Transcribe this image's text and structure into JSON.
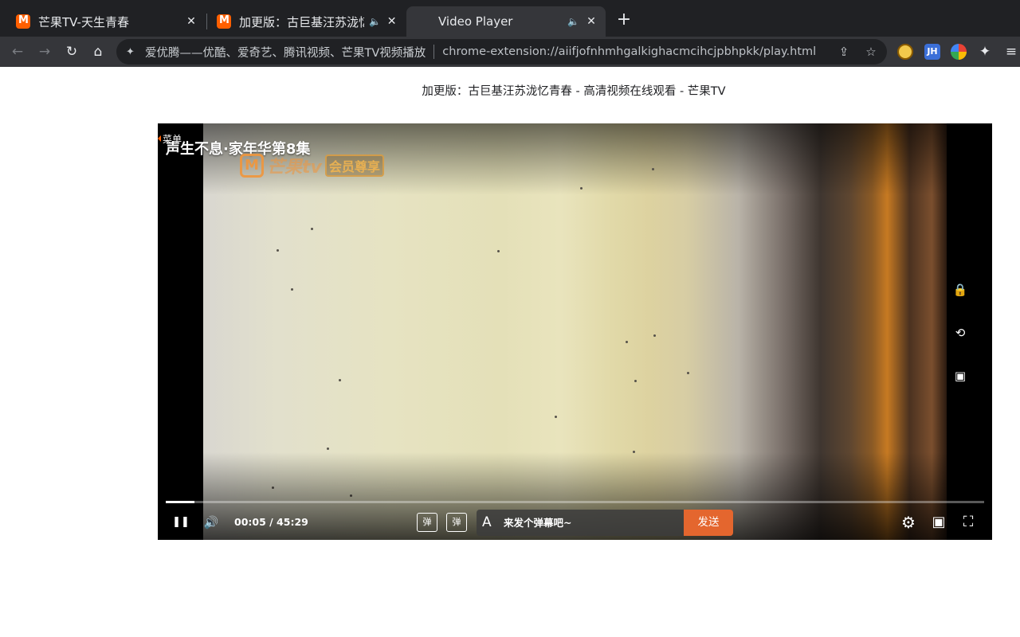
{
  "tabs": [
    {
      "title": "芒果TV-天生青春",
      "favicon": "mango-tv-icon",
      "audio": false
    },
    {
      "title": "加更版：古巨基汪苏泷忆青春",
      "favicon": "mango-tv-icon",
      "audio": true
    },
    {
      "title": "Video Player",
      "favicon": "video-player-icon",
      "audio": true,
      "active": true
    }
  ],
  "icons": {
    "close": "✕",
    "audio": "🔈",
    "new_tab": "+",
    "back": "←",
    "forward": "→",
    "reload": "↻",
    "home": "⌂",
    "puzzle": "✦",
    "share": "⇪",
    "star": "☆",
    "menu": "≡",
    "pause": "❚❚",
    "volume": "🔊",
    "lock": "🔒",
    "rotate": "⟲",
    "pip": "▣",
    "settings": "⚙",
    "fullscreen": "⛶"
  },
  "omnibox": {
    "site_name": "爱优腾——优酷、爱奇艺、腾讯视频、芒果TV视频播放",
    "url": "chrome-extension://aiifjofnhmhgalkighacmcihcjpbhpkk/play.html"
  },
  "extensions": [
    {
      "name": "video-player-extension-icon",
      "label": "",
      "color": "#f2c94c"
    },
    {
      "name": "jh-extension-icon",
      "label": "JH",
      "color": "#3b6fd8"
    },
    {
      "name": "colorful-extension-icon",
      "label": "",
      "color": "#d34"
    }
  ],
  "page": {
    "title": "加更版：古巨基汪苏泷忆青春 - 高清视频在线观看 - 芒果TV"
  },
  "player": {
    "menu_label": "菜单",
    "video_title": "声生不息·家年华第8集",
    "watermark": {
      "logo": "M",
      "text": "芒果tv",
      "badge": "会员尊享"
    },
    "time_display": "00:05 / 45:29",
    "progress_fraction": 0.035,
    "danmaku_toggle_label": "弹",
    "danmaku_settings_label": "弹",
    "danmaku_style_icon": "A",
    "danmaku_placeholder": "来发个弹幕吧~",
    "send_label": "发送"
  },
  "colors": {
    "accent": "#e4662e",
    "mango_orange": "#ff5f00"
  }
}
